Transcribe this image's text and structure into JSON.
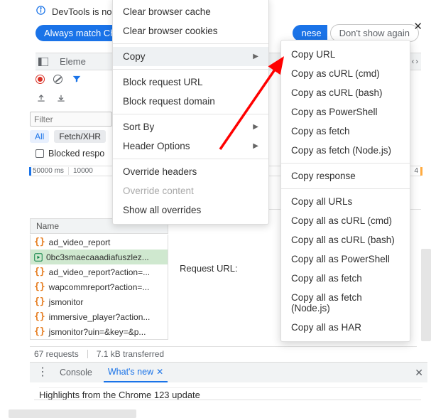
{
  "banner": {
    "text": "DevTools is no"
  },
  "match_chip": "Always match Ch",
  "lang_chip": "nese",
  "dont_show": "Don't show again",
  "tabs": {
    "elements": "Eleme"
  },
  "filter_placeholder": "Filter",
  "filter_pills": {
    "all": "All",
    "fetch_xhr": "Fetch/XHR"
  },
  "blocked_resp": "Blocked respo",
  "timeline": {
    "t1": "50000 ms",
    "t2": "10000",
    "t_last": "4"
  },
  "name_header": "Name",
  "requests": [
    {
      "name": "ad_video_report",
      "sel": false,
      "icon": "braces"
    },
    {
      "name": "0bc3smaecaaadiafuszlez...",
      "sel": true,
      "icon": "play"
    },
    {
      "name": "ad_video_report?action=...",
      "sel": false,
      "icon": "braces"
    },
    {
      "name": "wapcommreport?action=...",
      "sel": false,
      "icon": "braces"
    },
    {
      "name": "jsmonitor",
      "sel": false,
      "icon": "braces"
    },
    {
      "name": "immersive_player?action...",
      "sel": false,
      "icon": "braces"
    },
    {
      "name": "jsmonitor?uin=&key=&p...",
      "sel": false,
      "icon": "braces"
    }
  ],
  "stats": {
    "reqs": "67 requests",
    "transfer": "7.1 kB transferred"
  },
  "req_url_label": "Request URL:",
  "drawer": {
    "console": "Console",
    "whatsnew": "What's new"
  },
  "highlight_line": "Highlights from the Chrome 123 update",
  "ctx": {
    "clear_cache": "Clear browser cache",
    "clear_cookies": "Clear browser cookies",
    "copy": "Copy",
    "block_url": "Block request URL",
    "block_domain": "Block request domain",
    "sort_by": "Sort By",
    "header_opts": "Header Options",
    "override_headers": "Override headers",
    "override_content": "Override content",
    "show_all_overrides": "Show all overrides"
  },
  "sub": {
    "copy_url": "Copy URL",
    "curl_cmd": "Copy as cURL (cmd)",
    "curl_bash": "Copy as cURL (bash)",
    "powershell": "Copy as PowerShell",
    "fetch": "Copy as fetch",
    "fetch_node": "Copy as fetch (Node.js)",
    "response": "Copy response",
    "all_urls": "Copy all URLs",
    "all_curl_cmd": "Copy all as cURL (cmd)",
    "all_curl_bash": "Copy all as cURL (bash)",
    "all_powershell": "Copy all as PowerShell",
    "all_fetch": "Copy all as fetch",
    "all_fetch_node": "Copy all as fetch (Node.js)",
    "all_har": "Copy all as HAR"
  }
}
